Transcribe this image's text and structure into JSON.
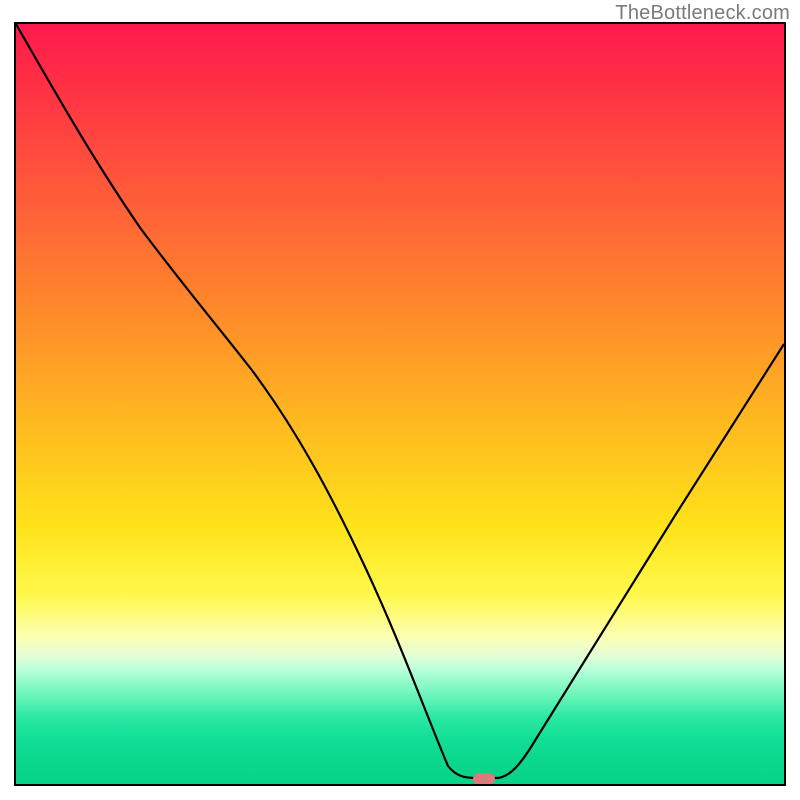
{
  "watermark": "TheBottleneck.com",
  "marker": {
    "x_pct": 61.0,
    "y_pct": 99.3
  },
  "chart_data": {
    "type": "line",
    "title": "",
    "xlabel": "",
    "ylabel": "",
    "xlim": [
      0,
      100
    ],
    "ylim": [
      0,
      100
    ],
    "note": "Background is a vertical gradient from red at the top through orange and yellow to green at the bottom. A single black curve descends from the top-left, reaches a minimum near x≈58–62 at the bottom edge, and rises toward the right edge. A small pink pill marker sits at the curve minimum.",
    "series": [
      {
        "name": "curve",
        "x": [
          0,
          5,
          10,
          15,
          20,
          25,
          30,
          35,
          40,
          45,
          50,
          55,
          58,
          60,
          62,
          65,
          70,
          75,
          80,
          85,
          90,
          95,
          100
        ],
        "y": [
          100,
          91,
          82,
          74,
          68,
          63,
          56,
          48,
          38,
          27,
          15,
          4,
          0.8,
          0.6,
          0.8,
          3,
          10,
          18,
          27,
          36,
          45,
          53,
          60
        ]
      }
    ],
    "marker_point": {
      "x": 61,
      "y": 0.7
    }
  }
}
